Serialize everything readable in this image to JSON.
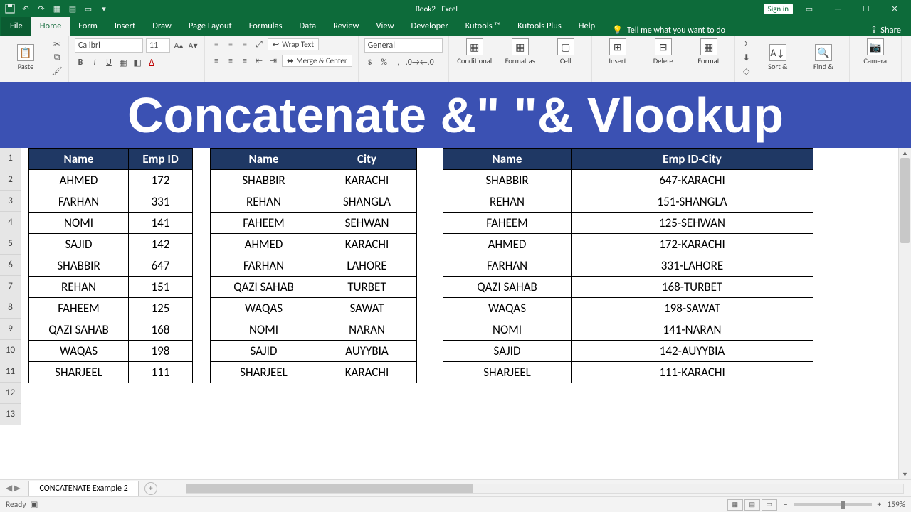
{
  "app": {
    "title": "Book2  -  Excel",
    "signin": "Sign in"
  },
  "tabs": {
    "file": "File",
    "home": "Home",
    "form": "Form",
    "insert": "Insert",
    "draw": "Draw",
    "pagelayout": "Page Layout",
    "formulas": "Formulas",
    "data": "Data",
    "review": "Review",
    "view": "View",
    "developer": "Developer",
    "kutools": "Kutools ™",
    "kutoolsplus": "Kutools Plus",
    "help": "Help",
    "tellme": "Tell me what you want to do",
    "share": "Share"
  },
  "ribbon": {
    "paste": "Paste",
    "font_name": "Calibri",
    "font_size": "11",
    "wrap": "Wrap Text",
    "merge": "Merge & Center",
    "numfmt": "General",
    "conditional": "Conditional",
    "formatas": "Format as",
    "cell": "Cell",
    "insert": "Insert",
    "delete": "Delete",
    "format": "Format",
    "sort": "Sort &",
    "find": "Find &",
    "camera": "Camera"
  },
  "banner": "Concatenate &\" \"& Vlookup",
  "rows": [
    "1",
    "2",
    "3",
    "4",
    "5",
    "6",
    "7",
    "8",
    "9",
    "10",
    "11",
    "12",
    "13"
  ],
  "table1": {
    "headers": [
      "Name",
      "Emp ID"
    ],
    "rows": [
      [
        "AHMED",
        "172"
      ],
      [
        "FARHAN",
        "331"
      ],
      [
        "NOMI",
        "141"
      ],
      [
        "SAJID",
        "142"
      ],
      [
        "SHABBIR",
        "647"
      ],
      [
        "REHAN",
        "151"
      ],
      [
        "FAHEEM",
        "125"
      ],
      [
        "QAZI SAHAB",
        "168"
      ],
      [
        "WAQAS",
        "198"
      ],
      [
        "SHARJEEL",
        "111"
      ]
    ]
  },
  "table2": {
    "headers": [
      "Name",
      "City"
    ],
    "rows": [
      [
        "SHABBIR",
        "KARACHI"
      ],
      [
        "REHAN",
        "SHANGLA"
      ],
      [
        "FAHEEM",
        "SEHWAN"
      ],
      [
        "AHMED",
        "KARACHI"
      ],
      [
        "FARHAN",
        "LAHORE"
      ],
      [
        "QAZI SAHAB",
        "TURBET"
      ],
      [
        "WAQAS",
        "SAWAT"
      ],
      [
        "NOMI",
        "NARAN"
      ],
      [
        "SAJID",
        "AUYYBIA"
      ],
      [
        "SHARJEEL",
        "KARACHI"
      ]
    ]
  },
  "table3": {
    "headers": [
      "Name",
      "Emp ID-City"
    ],
    "rows": [
      [
        "SHABBIR",
        "647-KARACHI"
      ],
      [
        "REHAN",
        "151-SHANGLA"
      ],
      [
        "FAHEEM",
        "125-SEHWAN"
      ],
      [
        "AHMED",
        "172-KARACHI"
      ],
      [
        "FARHAN",
        "331-LAHORE"
      ],
      [
        "QAZI SAHAB",
        "168-TURBET"
      ],
      [
        "WAQAS",
        "198-SAWAT"
      ],
      [
        "NOMI",
        "141-NARAN"
      ],
      [
        "SAJID",
        "142-AUYYBIA"
      ],
      [
        "SHARJEEL",
        "111-KARACHI"
      ]
    ]
  },
  "sheet": {
    "tab": "CONCATENATE Example 2"
  },
  "status": {
    "ready": "Ready",
    "zoom": "159%"
  },
  "colwidths": {
    "t1": [
      140,
      90
    ],
    "t2": [
      150,
      140
    ],
    "t3": [
      180,
      340
    ]
  }
}
